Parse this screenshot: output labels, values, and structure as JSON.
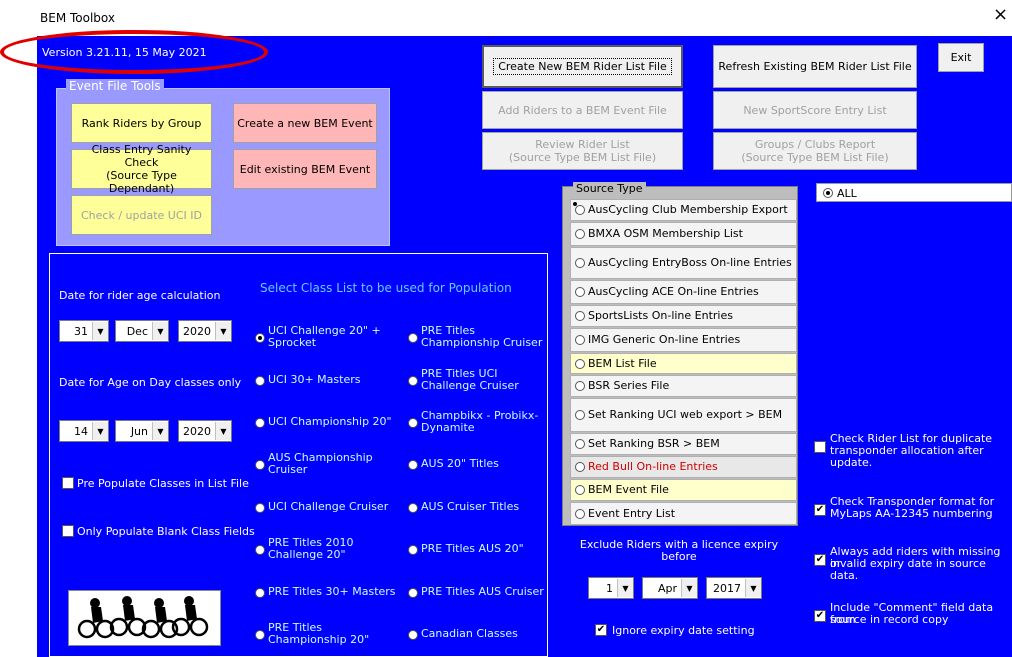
{
  "window": {
    "title": "BEM Toolbox",
    "close": "×"
  },
  "version": "Version 3.21.11, 15 May 2021",
  "top_buttons": {
    "create": "Create New BEM Rider List File",
    "refresh": "Refresh Existing BEM Rider List File",
    "exit": "Exit",
    "add_riders": "Add Riders to a BEM Event File",
    "sportscore": "New SportScore Entry List",
    "review_l1": "Review Rider List",
    "review_l2": "(Source Type BEM List File)",
    "groups_l1": "Groups / Clubs Report",
    "groups_l2": "(Source Type BEM List File)"
  },
  "event_tools": {
    "label": "Event File Tools",
    "rank": "Rank Riders by Group",
    "create_event": "Create a new BEM Event",
    "sanity_l1": "Class Entry Sanity Check",
    "sanity_l2": "(Source Type Dependant)",
    "edit_event": "Edit existing BEM Event",
    "check_uci": "Check / update UCI ID"
  },
  "population": {
    "heading": "Select Class List to be used for Population",
    "age_calc_label": "Date for rider age calculation",
    "age_day_label": "Date for Age on Day classes only",
    "date1": {
      "day": "31",
      "month": "Dec",
      "year": "2020"
    },
    "date2": {
      "day": "14",
      "month": "Jun",
      "year": "2020"
    },
    "pre_populate": "Pre Populate Classes in List File",
    "only_blank": "Only Populate Blank Class Fields",
    "classes_left": [
      {
        "l1": "UCI Challenge 20\" +",
        "l2": "Sprocket",
        "selected": true
      },
      {
        "l1": "UCI 30+ Masters",
        "l2": ""
      },
      {
        "l1": "UCI Championship 20\"",
        "l2": ""
      },
      {
        "l1": "AUS Championship",
        "l2": "Cruiser"
      },
      {
        "l1": "UCI Challenge Cruiser",
        "l2": ""
      },
      {
        "l1": "PRE Titles 2010",
        "l2": "Challenge 20\""
      },
      {
        "l1": "PRE Titles 30+ Masters",
        "l2": ""
      },
      {
        "l1": "PRE Titles",
        "l2": "Championship 20\""
      }
    ],
    "classes_right": [
      {
        "l1": "PRE Titles",
        "l2": "Championship Cruiser"
      },
      {
        "l1": "PRE Titles UCI",
        "l2": "Challenge Cruiser"
      },
      {
        "l1": "Champbikx - Probikx-",
        "l2": "Dynamite"
      },
      {
        "l1": "AUS 20\" Titles",
        "l2": ""
      },
      {
        "l1": "AUS Cruiser Titles",
        "l2": ""
      },
      {
        "l1": "PRE Titles AUS 20\"",
        "l2": ""
      },
      {
        "l1": "PRE Titles AUS Cruiser",
        "l2": ""
      },
      {
        "l1": "Canadian Classes",
        "l2": ""
      }
    ]
  },
  "source_type": {
    "label": "Source Type",
    "items": [
      {
        "text": "AusCycling Club Membership Export",
        "selected": true
      },
      {
        "text": "BMXA OSM Membership List"
      },
      {
        "text": "AusCycling EntryBoss On-line Entries"
      },
      {
        "text": "AusCycling ACE On-line Entries"
      },
      {
        "text": "SportsLists On-line Entries"
      },
      {
        "text": "IMG Generic On-line Entries"
      },
      {
        "text": "BEM List File"
      },
      {
        "text": "BSR Series File"
      },
      {
        "text": "Set Ranking UCI web export > BEM"
      },
      {
        "text": "Set Ranking BSR > BEM"
      },
      {
        "text": "Red Bull On-line Entries"
      },
      {
        "text": "BEM Event File"
      },
      {
        "text": "Event Entry List"
      }
    ]
  },
  "all_option": "ALL",
  "expiry": {
    "l1": "Exclude Riders with a licence expiry",
    "l2": "before",
    "day": "1",
    "month": "Apr",
    "year": "2017",
    "ignore": "Ignore expiry date setting"
  },
  "options": {
    "dup": {
      "l1": "Check Rider List for duplicate",
      "l2": "transponder allocation after update."
    },
    "fmt": {
      "l1": "Check Transponder format for",
      "l2": "MyLaps AA-12345 numbering"
    },
    "missing": {
      "l1": "Always add riders with  missing or",
      "l2": "invalid expiry date in source data."
    },
    "comment": {
      "l1": "Include \"Comment\" field data from",
      "l2": "source in record copy"
    }
  },
  "colors": {
    "client_bg": "#0000ff",
    "highlight": "#e00000",
    "button_yellow": "#ffff99",
    "button_pink": "#ffb6b6"
  }
}
